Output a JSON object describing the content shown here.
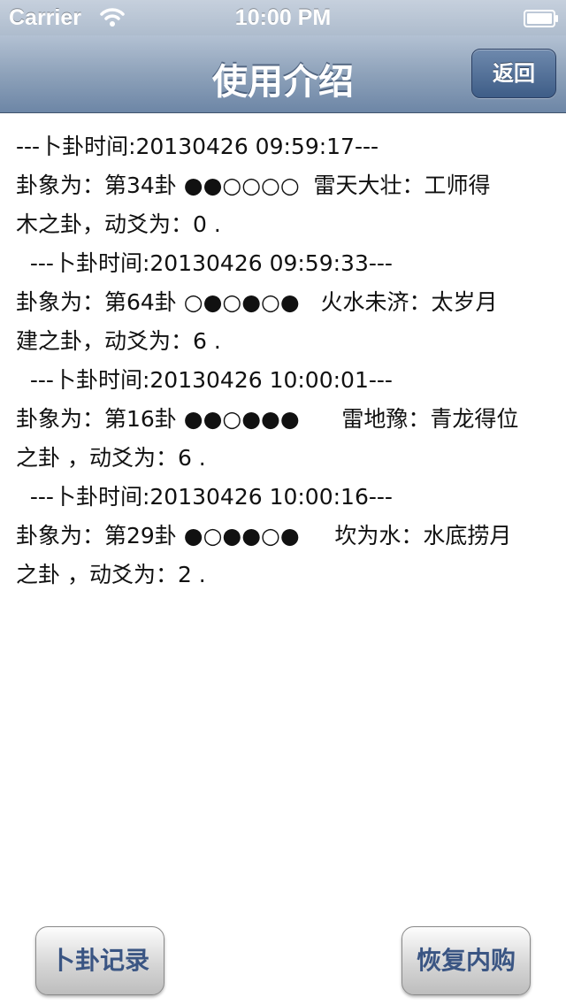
{
  "status_bar": {
    "carrier": "Carrier",
    "time": "10:00 PM",
    "wifi_icon": "wifi-icon",
    "battery_icon": "battery-icon"
  },
  "nav": {
    "title": "使用介绍",
    "back_label": "返回"
  },
  "records": [
    {
      "header": "---卜卦时间:20130426 09:59:17---",
      "line1": "卦象为：第34卦 ●●○○○○  雷天大壮：工师得",
      "line2": "木之卦，动爻为：0 ."
    },
    {
      "header": "  ---卜卦时间:20130426 09:59:33---",
      "line1": "卦象为：第64卦 ○●○●○●   火水未济：太岁月",
      "line2": "建之卦，动爻为：6 ."
    },
    {
      "header": "  ---卜卦时间:20130426 10:00:01---",
      "line1": "卦象为：第16卦 ●●○●●●      雷地豫：青龙得位",
      "line2": "之卦 ，动爻为：6 ."
    },
    {
      "header": "  ---卜卦时间:20130426 10:00:16---",
      "line1": "卦象为：第29卦 ●○●●○●     坎为水：水底捞月",
      "line2": "之卦 ，动爻为：2 ."
    }
  ],
  "footer": {
    "left_button": "卜卦记录",
    "right_button": "恢复内购"
  },
  "colors": {
    "nav_bar": "#8ea2ba",
    "button_text": "#3a5583"
  }
}
